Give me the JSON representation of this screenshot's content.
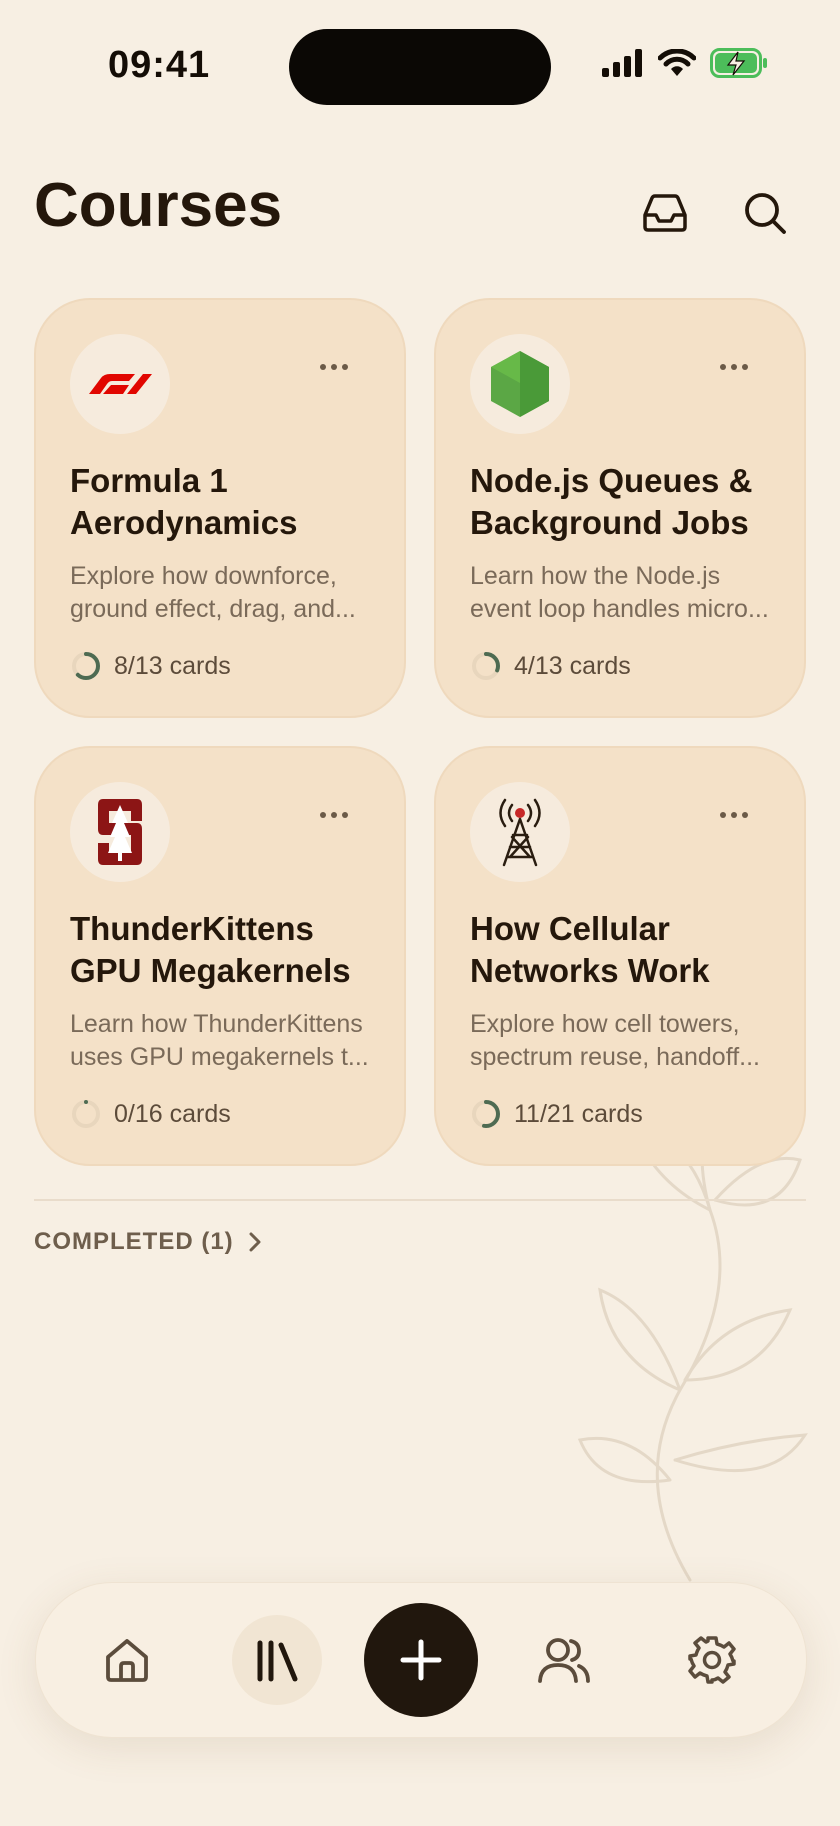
{
  "status": {
    "time": "09:41"
  },
  "header": {
    "title": "Courses"
  },
  "courses": [
    {
      "title": "Formula 1 Aerodynamics",
      "title_lines": [
        "Formula 1",
        "Aerodynamics"
      ],
      "desc_lines": [
        "Explore how downforce,",
        "ground effect, drag, and..."
      ],
      "progress": "8/13 cards",
      "progress_fraction": 0.615,
      "logo": "f1-logo"
    },
    {
      "title": "Node.js Queues & Background Jobs",
      "title_lines": [
        "Node.js Queues &",
        "Background Jobs"
      ],
      "desc_lines": [
        "Learn how the Node.js",
        "event loop handles micro..."
      ],
      "progress": "4/13 cards",
      "progress_fraction": 0.308,
      "logo": "nodejs-logo"
    },
    {
      "title": "ThunderKittens GPU Megakernels",
      "title_lines": [
        "ThunderKittens",
        "GPU Megakernels"
      ],
      "desc_lines": [
        "Learn how ThunderKittens",
        "uses GPU megakernels t..."
      ],
      "progress": "0/16 cards",
      "progress_fraction": 0.0,
      "logo": "stanford-logo"
    },
    {
      "title": "How Cellular Networks Work",
      "title_lines": [
        "How Cellular",
        "Networks Work"
      ],
      "desc_lines": [
        "Explore how cell towers,",
        "spectrum reuse, handoff..."
      ],
      "progress": "11/21 cards",
      "progress_fraction": 0.524,
      "logo": "cell-tower-icon"
    }
  ],
  "completed": {
    "label": "COMPLETED (1)"
  },
  "tabbar": {
    "items": [
      {
        "name": "home",
        "icon": "home-icon"
      },
      {
        "name": "library",
        "icon": "library-icon",
        "active": true
      },
      {
        "name": "add",
        "icon": "plus-icon"
      },
      {
        "name": "people",
        "icon": "people-icon"
      },
      {
        "name": "settings",
        "icon": "gear-icon"
      }
    ]
  },
  "colors": {
    "background": "#f7efe3",
    "card": "#f4e1c8",
    "progress": "#4e6b52",
    "accent_dark": "#21170d"
  }
}
